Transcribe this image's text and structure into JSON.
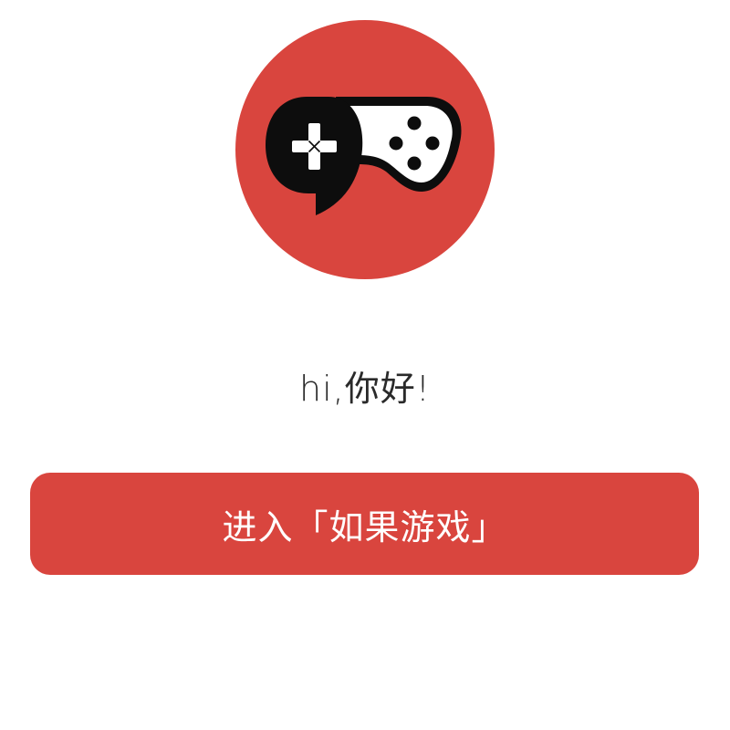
{
  "colors": {
    "brand_red": "#d9453e",
    "background": "#ffffff",
    "greeting_text": "#2a2a2a",
    "button_text": "#ffffff",
    "icon_dark": "#0d0d0d"
  },
  "logo": {
    "icon": "gamepad-chat-icon"
  },
  "greeting": {
    "text": "hi,你好!"
  },
  "enter_button": {
    "label": "进入「如果游戏」"
  }
}
